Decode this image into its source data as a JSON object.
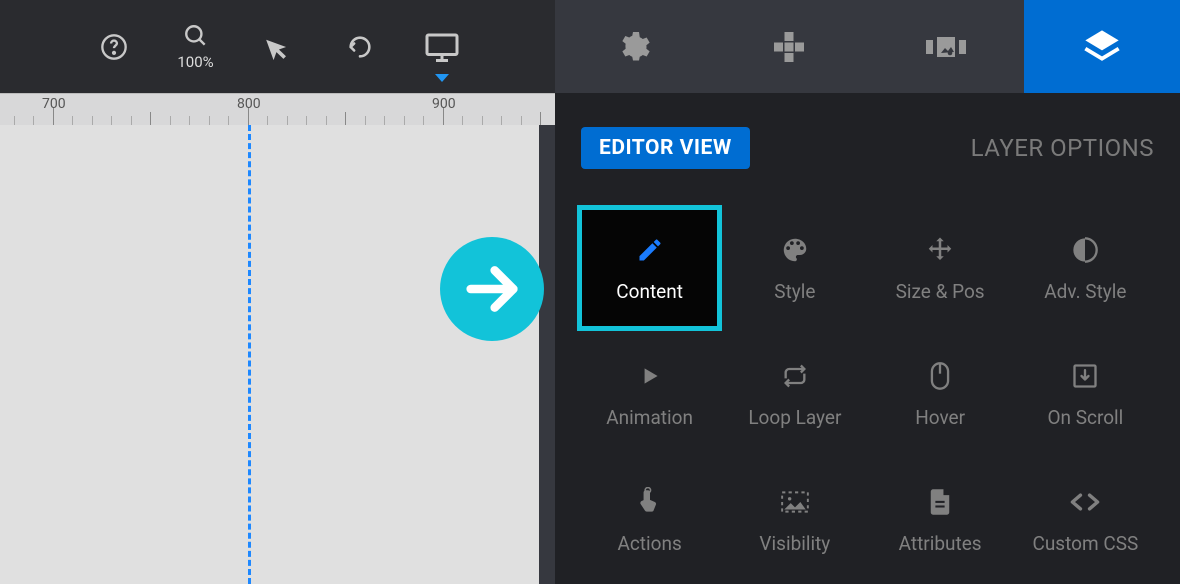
{
  "toolbar": {
    "zoom_label": "100%",
    "ruler_marks": [
      "700",
      "800",
      "900"
    ]
  },
  "sidebar": {
    "editor_view_label": "EDITOR VIEW",
    "layer_options_label": "LAYER OPTIONS",
    "tiles": [
      {
        "label": "Content"
      },
      {
        "label": "Style"
      },
      {
        "label": "Size & Pos"
      },
      {
        "label": "Adv. Style"
      },
      {
        "label": "Animation"
      },
      {
        "label": "Loop Layer"
      },
      {
        "label": "Hover"
      },
      {
        "label": "On Scroll"
      },
      {
        "label": "Actions"
      },
      {
        "label": "Visibility"
      },
      {
        "label": "Attributes"
      },
      {
        "label": "Custom CSS"
      }
    ]
  }
}
